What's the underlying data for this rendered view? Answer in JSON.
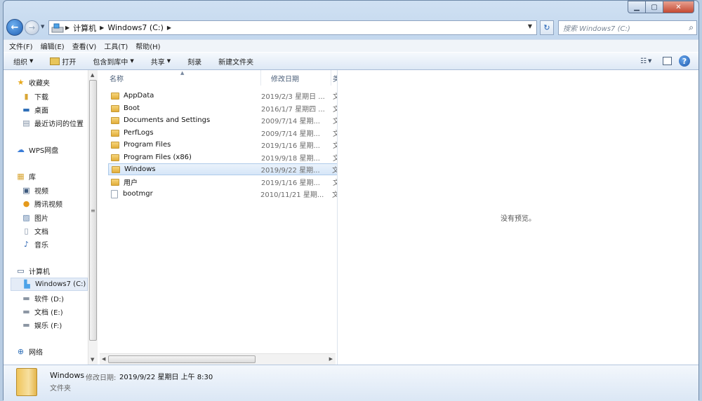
{
  "address": {
    "crumbs": [
      "计算机",
      "Windows7 (C:)"
    ],
    "search_placeholder": "搜索 Windows7 (C:)"
  },
  "menu": [
    "文件(F)",
    "编辑(E)",
    "查看(V)",
    "工具(T)",
    "帮助(H)"
  ],
  "toolbar": {
    "organize": "组织",
    "open": "打开",
    "include": "包含到库中",
    "share": "共享",
    "burn": "刻录",
    "new_folder": "新建文件夹"
  },
  "nav": {
    "favorites": "收藏夹",
    "fav_items": [
      "下载",
      "桌面",
      "最近访问的位置"
    ],
    "wps": "WPS网盘",
    "library": "库",
    "lib_items": [
      "视频",
      "腾讯视频",
      "图片",
      "文档",
      "音乐"
    ],
    "computer": "计算机",
    "drives": [
      "Windows7 (C:)",
      "软件 (D:)",
      "文档 (E:)",
      "娱乐 (F:)"
    ],
    "network": "网络"
  },
  "columns": {
    "name": "名称",
    "date": "修改日期",
    "type": "类"
  },
  "files": [
    {
      "name": "AppData",
      "date": "2019/2/3 星期日 ...",
      "type": "文",
      "kind": "folder"
    },
    {
      "name": "Boot",
      "date": "2016/1/7 星期四 ...",
      "type": "文",
      "kind": "folder"
    },
    {
      "name": "Documents and Settings",
      "date": "2009/7/14 星期...",
      "type": "文",
      "kind": "folder"
    },
    {
      "name": "PerfLogs",
      "date": "2009/7/14 星期...",
      "type": "文",
      "kind": "folder"
    },
    {
      "name": "Program Files",
      "date": "2019/1/16 星期...",
      "type": "文",
      "kind": "folder"
    },
    {
      "name": "Program Files (x86)",
      "date": "2019/9/18 星期...",
      "type": "文",
      "kind": "folder"
    },
    {
      "name": "Windows",
      "date": "2019/9/22 星期...",
      "type": "文",
      "kind": "folder",
      "selected": true
    },
    {
      "name": "用户",
      "date": "2019/1/16 星期...",
      "type": "文",
      "kind": "folder"
    },
    {
      "name": "bootmgr",
      "date": "2010/11/21 星期...",
      "type": "文",
      "kind": "file"
    }
  ],
  "preview": "没有预览。",
  "details": {
    "name": "Windows",
    "label": "修改日期:",
    "date": "2019/9/22 星期日 上午 8:30",
    "type": "文件夹"
  }
}
